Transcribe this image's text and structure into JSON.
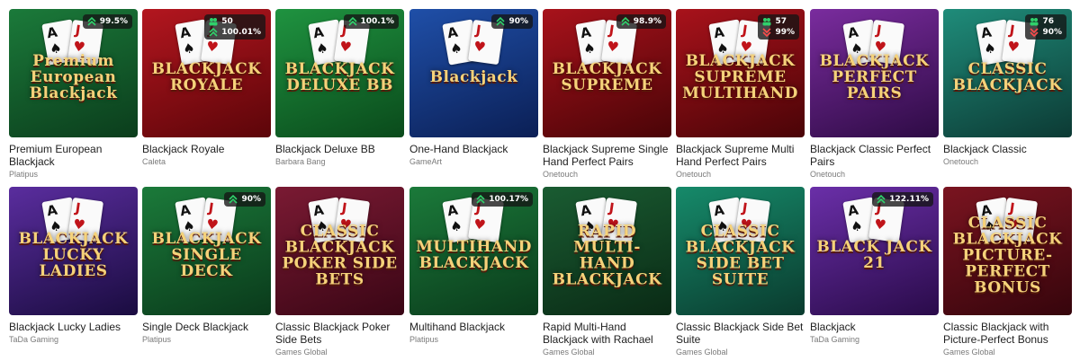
{
  "colors": {
    "rtp_up": "#2fd16b",
    "rtp_down": "#ff4b4b",
    "badge_bg": "#161616"
  },
  "games": [
    {
      "title": "Premium European Blackjack",
      "provider": "Platipus",
      "art": "Premium European Blackjack",
      "bg": "linear-gradient(160deg,#1b7a3a,#0b3d1c)",
      "rtp": "99.5%",
      "rtp_dir": "up"
    },
    {
      "title": "Blackjack Royale",
      "provider": "Caleta",
      "art": "BLACKJACK ROYALE",
      "bg": "linear-gradient(160deg,#b3161f,#5c0509)",
      "players": "50",
      "rtp": "100.01%",
      "rtp_dir": "up"
    },
    {
      "title": "Blackjack Deluxe BB",
      "provider": "Barbara Bang",
      "art": "BLACKJACK DELUXE BB",
      "bg": "linear-gradient(160deg,#1f9340,#0a4a1b)",
      "rtp": "100.1%",
      "rtp_dir": "up"
    },
    {
      "title": "One-Hand Blackjack",
      "provider": "GameArt",
      "art": "Blackjack",
      "bg": "linear-gradient(160deg,#1f4fa8,#0b1f55)",
      "rtp": "90%",
      "rtp_dir": "up"
    },
    {
      "title": "Blackjack Supreme Single Hand Perfect Pairs",
      "provider": "Onetouch",
      "art": "BLACKJACK SUPREME",
      "bg": "linear-gradient(160deg,#a8121b,#4a0407)",
      "rtp": "98.9%",
      "rtp_dir": "up"
    },
    {
      "title": "Blackjack Supreme Multi Hand Perfect Pairs",
      "provider": "Onetouch",
      "art": "BLACKJACK SUPREME MULTIHAND",
      "bg": "linear-gradient(160deg,#a8121b,#4a0407)",
      "players": "57",
      "rtp": "99%",
      "rtp_dir": "down"
    },
    {
      "title": "Blackjack Classic Perfect Pairs",
      "provider": "Onetouch",
      "art": "BLACKJACK PERFECT PAIRS",
      "bg": "linear-gradient(160deg,#7a2c9e,#2e0b45)",
      "rtp": "",
      "rtp_dir": "none"
    },
    {
      "title": "Blackjack Classic",
      "provider": "Onetouch",
      "art": "CLASSIC BLACKJACK",
      "bg": "linear-gradient(160deg,#1f8c7a,#0c3a34)",
      "players": "76",
      "rtp": "90%",
      "rtp_dir": "down"
    },
    {
      "title": "Blackjack Lucky Ladies",
      "provider": "TaDa Gaming",
      "art": "BLACKJACK LUCKY LADIES",
      "bg": "linear-gradient(160deg,#5a2d9e,#1a0c40)",
      "rtp": "",
      "rtp_dir": "none"
    },
    {
      "title": "Single Deck Blackjack",
      "provider": "Platipus",
      "art": "BLACKJACK SINGLE DECK",
      "bg": "linear-gradient(160deg,#1b7a3a,#0a3a1b)",
      "rtp": "90%",
      "rtp_dir": "up"
    },
    {
      "title": "Classic Blackjack Poker Side Bets",
      "provider": "Games Global",
      "art": "CLASSIC BLACKJACK POKER SIDE BETS",
      "bg": "linear-gradient(160deg,#7a1a33,#3a0615)",
      "rtp": "",
      "rtp_dir": "none"
    },
    {
      "title": "Multihand Blackjack",
      "provider": "Platipus",
      "art": "MULTIHAND BLACKJACK",
      "bg": "linear-gradient(160deg,#1b7a3a,#0a3a1b)",
      "rtp": "100.17%",
      "rtp_dir": "up"
    },
    {
      "title": "Rapid Multi-Hand Blackjack with Rachael",
      "provider": "Games Global",
      "art": "RAPID MULTI-HAND BLACKJACK",
      "bg": "linear-gradient(160deg,#1a5c32,#0a2a15)",
      "rtp": "",
      "rtp_dir": "none"
    },
    {
      "title": "Classic Blackjack Side Bet Suite",
      "provider": "Games Global",
      "art": "CLASSIC BLACKJACK SIDE BET SUITE",
      "bg": "linear-gradient(160deg,#168a6a,#0a3b2e)",
      "rtp": "",
      "rtp_dir": "none"
    },
    {
      "title": "Blackjack",
      "provider": "TaDa Gaming",
      "art": "BLACK JACK 21",
      "bg": "linear-gradient(160deg,#6a2fa8,#2a0b4a)",
      "rtp": "122.11%",
      "rtp_dir": "up"
    },
    {
      "title": "Classic Blackjack with Picture-Perfect Bonus",
      "provider": "Games Global",
      "art": "CLASSIC BLACKJACK PICTURE-PERFECT BONUS",
      "bg": "linear-gradient(160deg,#7a1420,#36050c)",
      "rtp": "",
      "rtp_dir": "none"
    }
  ]
}
